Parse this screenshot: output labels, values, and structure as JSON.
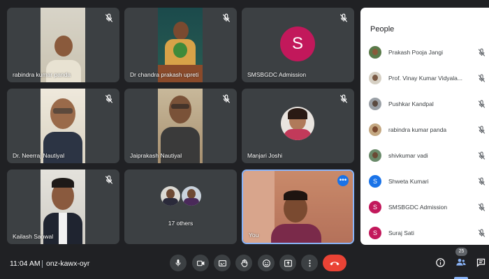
{
  "tiles": {
    "t1": {
      "name": "rabindra kumar panda"
    },
    "t2": {
      "name": "Dr chandra prakash upreti"
    },
    "t3": {
      "name": "SMSBGDC Admission",
      "initial": "S"
    },
    "t4": {
      "name": "Dr. Neerraj Nautiyal"
    },
    "t5": {
      "name": "Jaiprakash Nautiyal"
    },
    "t6": {
      "name": "Manjari Joshi"
    },
    "t7": {
      "name": "Kailash Sanwal"
    },
    "t8": {
      "name": "17 others"
    },
    "t9": {
      "name": "You",
      "more": "•••"
    }
  },
  "people": {
    "title": "People",
    "list": [
      {
        "name": "Prakash Pooja Jangi"
      },
      {
        "name": "Prof. Vinay Kumar Vidyala..."
      },
      {
        "name": "Pushkar Kandpal"
      },
      {
        "name": "rabindra kumar panda"
      },
      {
        "name": "shivkumar vadi"
      },
      {
        "name": "Shweta Kumari",
        "initial": "S"
      },
      {
        "name": "SMSBGDC Admission",
        "initial": "S"
      },
      {
        "name": "Suraj Sati",
        "initial": "S"
      }
    ]
  },
  "bottom": {
    "time": "11:04 AM",
    "meeting_code": "onz-kawx-oyr",
    "participant_count": "25"
  },
  "colors": {
    "background": "#202124",
    "tile": "#3c4043",
    "end_call": "#ea4335",
    "accent": "#8ab4f8",
    "avatar_pink": "#c2185b",
    "avatar_blue": "#1a73e8"
  }
}
